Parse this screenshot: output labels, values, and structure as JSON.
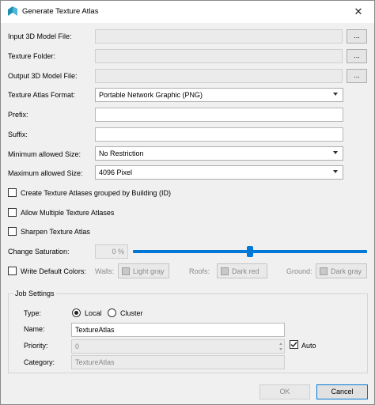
{
  "window": {
    "title": "Generate Texture Atlas",
    "close_glyph": "✕"
  },
  "form": {
    "input_model": {
      "label": "Input 3D Model File:",
      "value": "",
      "browse": "..."
    },
    "texture_folder": {
      "label": "Texture Folder:",
      "value": "",
      "browse": "..."
    },
    "output_model": {
      "label": "Output 3D Model File:",
      "value": "",
      "browse": "..."
    },
    "atlas_format": {
      "label": "Texture Atlas Format:",
      "selected": "Portable Network Graphic (PNG)"
    },
    "prefix": {
      "label": "Prefix:",
      "value": ""
    },
    "suffix": {
      "label": "Suffix:",
      "value": ""
    },
    "min_size": {
      "label": "Minimum allowed Size:",
      "selected": "No Restriction"
    },
    "max_size": {
      "label": "Maximum allowed Size:",
      "selected": "4096 Pixel"
    },
    "group_by_building": {
      "label": "Create Texture Atlases grouped by Building (ID)",
      "checked": false
    },
    "allow_multiple": {
      "label": "Allow Multiple Texture Atlases",
      "checked": false
    },
    "sharpen": {
      "label": "Sharpen Texture Atlas",
      "checked": false
    },
    "saturation": {
      "label": "Change Saturation:",
      "value_text": "0 %",
      "level_percent": 50
    },
    "write_default_colors": {
      "label": "Write Default Colors:",
      "checked": false,
      "walls_label": "Walls:",
      "walls_value": "Light gray",
      "roofs_label": "Roofs:",
      "roofs_value": "Dark red",
      "ground_label": "Ground:",
      "ground_value": "Dark gray"
    }
  },
  "job_settings": {
    "title": "Job Settings",
    "type_label": "Type:",
    "type_local": "Local",
    "type_cluster": "Cluster",
    "selected_type": "Local",
    "name_label": "Name:",
    "name_value": "TextureAtlas",
    "priority_label": "Priority:",
    "priority_value": "0",
    "auto_label": "Auto",
    "auto_checked": true,
    "category_label": "Category:",
    "category_value": "TextureAtlas"
  },
  "buttons": {
    "ok": "OK",
    "cancel": "Cancel"
  },
  "colors": {
    "accent": "#0078d7",
    "icon_teal": "#1c8fb4"
  }
}
